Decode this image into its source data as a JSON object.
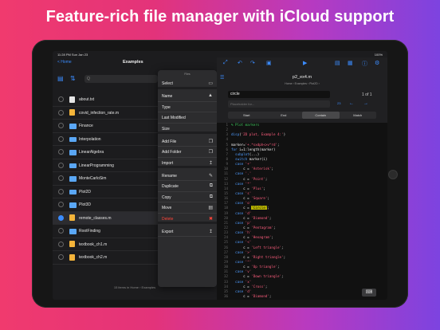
{
  "headline": "Feature-rich file manager with iCloud support",
  "status": {
    "time": "11:28 PM   Sun Jan 23",
    "battery": "100%"
  },
  "left": {
    "home_label": "< Home",
    "title": "Examples",
    "search_placeholder": "Q",
    "files": [
      {
        "name": "about.txt",
        "kind": "doc",
        "selected": false
      },
      {
        "name": "covid_infection_rate.m",
        "kind": "mfile",
        "selected": false
      },
      {
        "name": "Finance",
        "kind": "folder",
        "selected": false
      },
      {
        "name": "Interpolation",
        "kind": "folder",
        "selected": false
      },
      {
        "name": "LinearAlgebra",
        "kind": "folder",
        "selected": false
      },
      {
        "name": "LinearProgramming",
        "kind": "folder",
        "selected": false
      },
      {
        "name": "MonteCarloSim",
        "kind": "folder",
        "selected": false
      },
      {
        "name": "Plot2D",
        "kind": "folder",
        "selected": false
      },
      {
        "name": "Plot3D",
        "kind": "folder",
        "selected": false
      },
      {
        "name": "remote_classes.m",
        "kind": "mfile",
        "selected": true
      },
      {
        "name": "RootFinding",
        "kind": "folder",
        "selected": false
      },
      {
        "name": "textbook_ch1.m",
        "kind": "mfile",
        "selected": false
      },
      {
        "name": "textbook_ch2.m",
        "kind": "mfile",
        "selected": false
      }
    ],
    "last_info": "Friday, 08:55\n65 bytes",
    "footer": "15 items in Home › Examples"
  },
  "menu": {
    "title": "Files",
    "items": [
      {
        "label": "Select",
        "icon": "▭",
        "gap": true,
        "danger": false
      },
      {
        "label": "Name",
        "icon": "▲",
        "gap": false,
        "danger": false
      },
      {
        "label": "Type",
        "icon": "",
        "gap": false,
        "danger": false
      },
      {
        "label": "Last Modified",
        "icon": "",
        "gap": false,
        "danger": false
      },
      {
        "label": "Size",
        "icon": "",
        "gap": true,
        "danger": false
      },
      {
        "label": "Add File",
        "icon": "❐",
        "gap": false,
        "danger": false
      },
      {
        "label": "Add Folder",
        "icon": "❐",
        "gap": false,
        "danger": false
      },
      {
        "label": "Import",
        "icon": "↥",
        "gap": true,
        "danger": false
      },
      {
        "label": "Rename",
        "icon": "✎",
        "gap": false,
        "danger": false
      },
      {
        "label": "Duplicate",
        "icon": "⧉",
        "gap": false,
        "danger": false
      },
      {
        "label": "Copy",
        "icon": "⧉",
        "gap": false,
        "danger": false
      },
      {
        "label": "Move",
        "icon": "▤",
        "gap": false,
        "danger": false
      },
      {
        "label": "Delete",
        "icon": "✖",
        "gap": true,
        "danger": true
      },
      {
        "label": "Export",
        "icon": "↥",
        "gap": false,
        "danger": false
      }
    ]
  },
  "right": {
    "doc_title": "p2_ex4.m",
    "breadcrumb": "Home › Examples › Plot2D ›",
    "find_value": "circle",
    "replace_placeholder": "Placeholder for...",
    "match_count": "1 of 1",
    "replace_count": "23",
    "segments": [
      "Start",
      "End",
      "Contain",
      "Match"
    ],
    "active_segment": 2,
    "keyboard_icon": "⌨"
  },
  "code": [
    {
      "n": "1",
      "parts": [
        [
          "c-comment",
          "% Plot markers"
        ]
      ]
    },
    {
      "n": "2",
      "parts": [
        [
          "c-plain",
          ""
        ]
      ]
    },
    {
      "n": "3",
      "parts": [
        [
          "c-kw",
          "disp"
        ],
        [
          "c-plain",
          "("
        ],
        [
          "c-str",
          "'2D plot, Example 4:'"
        ],
        [
          "c-plain",
          ")"
        ]
      ]
    },
    {
      "n": "4",
      "parts": [
        [
          "c-plain",
          ""
        ]
      ]
    },
    {
      "n": "5",
      "parts": [
        [
          "c-plain",
          "marker="
        ],
        [
          "c-str",
          "'+.*sxdph<>v^rd'"
        ],
        [
          "c-plain",
          ";"
        ]
      ]
    },
    {
      "n": "6",
      "parts": [
        [
          "c-kw",
          "for"
        ],
        [
          "c-plain",
          " i=1:length(marker)"
        ]
      ]
    },
    {
      "n": "7",
      "parts": [
        [
          "c-plain",
          "  "
        ],
        [
          "c-kw",
          "subplot"
        ],
        [
          "c-plain",
          "(...)"
        ]
      ]
    },
    {
      "n": "8",
      "parts": [
        [
          "c-plain",
          "  "
        ],
        [
          "c-kw",
          "switch"
        ],
        [
          "c-plain",
          " marker(i)"
        ]
      ]
    },
    {
      "n": "9",
      "parts": [
        [
          "c-kw",
          "  case"
        ],
        [
          "c-plain",
          " "
        ],
        [
          "c-str",
          "'+'"
        ]
      ]
    },
    {
      "n": "10",
      "parts": [
        [
          "c-plain",
          "      c = "
        ],
        [
          "c-str",
          "'Asterisk'"
        ],
        [
          "c-plain",
          ";"
        ]
      ]
    },
    {
      "n": "11",
      "parts": [
        [
          "c-kw",
          "  case"
        ],
        [
          "c-plain",
          " "
        ],
        [
          "c-str",
          "'.'"
        ]
      ]
    },
    {
      "n": "12",
      "parts": [
        [
          "c-plain",
          "      c = "
        ],
        [
          "c-str",
          "'Point'"
        ],
        [
          "c-plain",
          ";"
        ]
      ]
    },
    {
      "n": "13",
      "parts": [
        [
          "c-kw",
          "  case"
        ],
        [
          "c-plain",
          " "
        ],
        [
          "c-str",
          "'*'"
        ]
      ]
    },
    {
      "n": "14",
      "parts": [
        [
          "c-plain",
          "      c = "
        ],
        [
          "c-str",
          "'Plus'"
        ],
        [
          "c-plain",
          ";"
        ]
      ]
    },
    {
      "n": "15",
      "parts": [
        [
          "c-kw",
          "  case"
        ],
        [
          "c-plain",
          " "
        ],
        [
          "c-str",
          "'s'"
        ]
      ]
    },
    {
      "n": "16",
      "parts": [
        [
          "c-plain",
          "      c = "
        ],
        [
          "c-str",
          "'Square'"
        ],
        [
          "c-plain",
          ";"
        ]
      ]
    },
    {
      "n": "17",
      "parts": [
        [
          "c-kw",
          "  case"
        ],
        [
          "c-plain",
          " "
        ],
        [
          "c-str",
          "'o'"
        ]
      ]
    },
    {
      "n": "18",
      "parts": [
        [
          "c-plain",
          "      c = "
        ],
        [
          "hl",
          "'Circle'"
        ],
        [
          "c-plain",
          ";"
        ]
      ]
    },
    {
      "n": "19",
      "parts": [
        [
          "c-kw",
          "  case"
        ],
        [
          "c-plain",
          " "
        ],
        [
          "c-str",
          "'d'"
        ]
      ]
    },
    {
      "n": "20",
      "parts": [
        [
          "c-plain",
          "      c = "
        ],
        [
          "c-str",
          "'Diamond'"
        ],
        [
          "c-plain",
          ";"
        ]
      ]
    },
    {
      "n": "21",
      "parts": [
        [
          "c-kw",
          "  case"
        ],
        [
          "c-plain",
          " "
        ],
        [
          "c-str",
          "'p'"
        ]
      ]
    },
    {
      "n": "22",
      "parts": [
        [
          "c-plain",
          "      c = "
        ],
        [
          "c-str",
          "'Pentagram'"
        ],
        [
          "c-plain",
          ";"
        ]
      ]
    },
    {
      "n": "23",
      "parts": [
        [
          "c-kw",
          "  case"
        ],
        [
          "c-plain",
          " "
        ],
        [
          "c-str",
          "'h'"
        ]
      ]
    },
    {
      "n": "24",
      "parts": [
        [
          "c-plain",
          "      c = "
        ],
        [
          "c-str",
          "'Hexagram'"
        ],
        [
          "c-plain",
          ";"
        ]
      ]
    },
    {
      "n": "25",
      "parts": [
        [
          "c-kw",
          "  case"
        ],
        [
          "c-plain",
          " "
        ],
        [
          "c-str",
          "'<'"
        ]
      ]
    },
    {
      "n": "26",
      "parts": [
        [
          "c-plain",
          "      c = "
        ],
        [
          "c-str",
          "'Left triangle'"
        ],
        [
          "c-plain",
          ";"
        ]
      ]
    },
    {
      "n": "27",
      "parts": [
        [
          "c-kw",
          "  case"
        ],
        [
          "c-plain",
          " "
        ],
        [
          "c-str",
          "'>'"
        ]
      ]
    },
    {
      "n": "28",
      "parts": [
        [
          "c-plain",
          "      c = "
        ],
        [
          "c-str",
          "'Right triangle'"
        ],
        [
          "c-plain",
          ";"
        ]
      ]
    },
    {
      "n": "29",
      "parts": [
        [
          "c-kw",
          "  case"
        ],
        [
          "c-plain",
          " "
        ],
        [
          "c-str",
          "'^'"
        ]
      ]
    },
    {
      "n": "30",
      "parts": [
        [
          "c-plain",
          "      c = "
        ],
        [
          "c-str",
          "'Up triangle'"
        ],
        [
          "c-plain",
          ";"
        ]
      ]
    },
    {
      "n": "31",
      "parts": [
        [
          "c-kw",
          "  case"
        ],
        [
          "c-plain",
          " "
        ],
        [
          "c-str",
          "'v'"
        ]
      ]
    },
    {
      "n": "32",
      "parts": [
        [
          "c-plain",
          "      c = "
        ],
        [
          "c-str",
          "'Down triangle'"
        ],
        [
          "c-plain",
          ";"
        ]
      ]
    },
    {
      "n": "33",
      "parts": [
        [
          "c-kw",
          "  case"
        ],
        [
          "c-plain",
          " "
        ],
        [
          "c-str",
          "'x'"
        ]
      ]
    },
    {
      "n": "34",
      "parts": [
        [
          "c-plain",
          "      c = "
        ],
        [
          "c-str",
          "'Cross'"
        ],
        [
          "c-plain",
          ";"
        ]
      ]
    },
    {
      "n": "35",
      "parts": [
        [
          "c-kw",
          "  case"
        ],
        [
          "c-plain",
          " "
        ],
        [
          "c-str",
          "'d'"
        ]
      ]
    },
    {
      "n": "36",
      "parts": [
        [
          "c-plain",
          "      c = "
        ],
        [
          "c-str",
          "'Diamond'"
        ],
        [
          "c-plain",
          ";"
        ]
      ]
    }
  ]
}
